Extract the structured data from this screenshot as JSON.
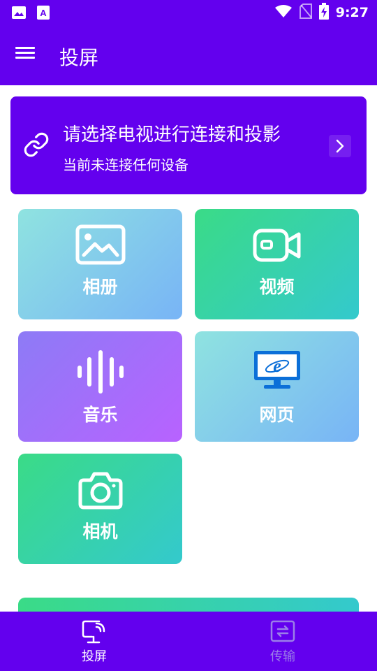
{
  "status_bar": {
    "time": "9:27",
    "icons": [
      "image-notification-icon",
      "text-notification-icon",
      "wifi-icon",
      "no-sim-icon",
      "battery-charging-icon"
    ]
  },
  "app_bar": {
    "title": "投屏",
    "menu_icon": "hamburger-menu-icon"
  },
  "connect_card": {
    "title": "请选择电视进行连接和投影",
    "subtitle": "当前未连接任何设备",
    "icon": "link-icon"
  },
  "tiles": [
    {
      "label": "相册",
      "icon": "image-icon"
    },
    {
      "label": "视频",
      "icon": "video-camera-icon"
    },
    {
      "label": "音乐",
      "icon": "sound-wave-icon"
    },
    {
      "label": "网页",
      "icon": "browser-monitor-icon"
    },
    {
      "label": "相机",
      "icon": "camera-icon"
    }
  ],
  "bottom_nav": {
    "items": [
      {
        "label": "投屏",
        "icon": "cast-icon",
        "active": true
      },
      {
        "label": "传输",
        "icon": "transfer-icon",
        "active": false
      }
    ]
  },
  "colors": {
    "primary": "#6300ee",
    "inactive_nav": "#9b7fe8"
  }
}
